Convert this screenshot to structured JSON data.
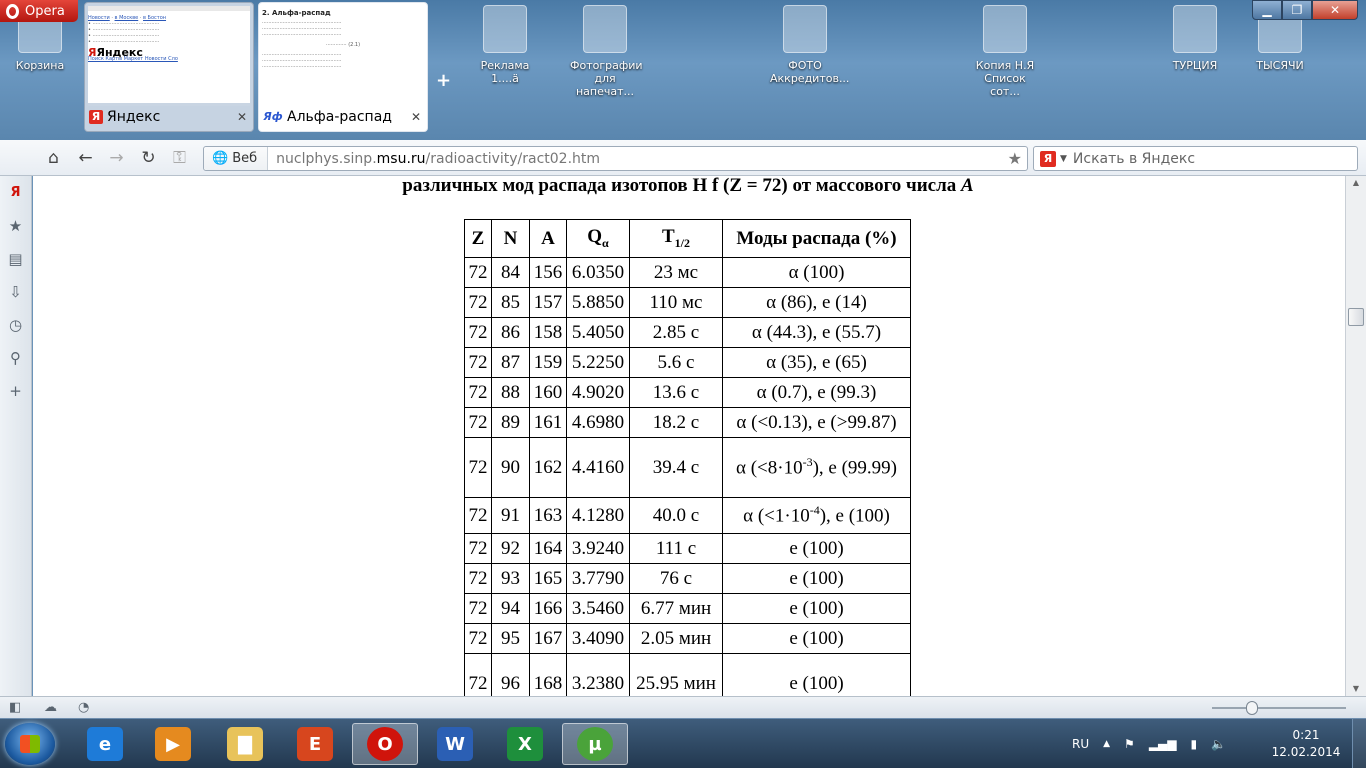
{
  "app": {
    "menu_label": "Opera",
    "window_controls": {
      "minimize": "▁",
      "maximize": "❐",
      "close": "✕"
    }
  },
  "desktop": {
    "icons": [
      "Корзина",
      "",
      "Реклама 1....ä",
      "Фотографии для напечат...",
      "ФОТО Аккредитов...",
      "",
      "Копия Н.Я Список сот...",
      "ТУРЦИЯ",
      "ТЫСЯЧИ"
    ]
  },
  "tabs": [
    {
      "title": "Яндекс",
      "favicon": "Я",
      "close": "✕",
      "thumb_lines": [
        "Новости",
        "в Москве",
        "в Бостон",
        "Яндекс"
      ],
      "thumb_nav": "Поиск Карты Маркет Новости Сло"
    },
    {
      "title": "Альфа-распад",
      "favicon": "Яф",
      "close": "✕",
      "thumb_heading": "2. Альфа-распад"
    }
  ],
  "new_tab": "+",
  "nav": {
    "home": "⌂",
    "back": "←",
    "forward": "→",
    "reload": "↻",
    "key": "⚿",
    "web_label": "Веб",
    "url_prefix": "nuclphys.sinp.",
    "url_domain": "msu.ru",
    "url_suffix": "/radioactivity/ract02.htm",
    "bookmark": "★",
    "search_placeholder": "Искать в Яндекс",
    "search_logo": "Я",
    "search_arrow": "▼"
  },
  "panel": {
    "icons": [
      {
        "name": "yandex-icon",
        "glyph": "Я"
      },
      {
        "name": "bookmarks-icon",
        "glyph": "★"
      },
      {
        "name": "notes-icon",
        "glyph": "▤"
      },
      {
        "name": "downloads-icon",
        "glyph": "⇩"
      },
      {
        "name": "history-icon",
        "glyph": "◷"
      },
      {
        "name": "search-panel-icon",
        "glyph": "⚲"
      },
      {
        "name": "add-panel-icon",
        "glyph": "+"
      }
    ]
  },
  "page": {
    "caption_text": "различных мод распада изотопов H f (Z = 72) от массового числа ",
    "caption_var": "A",
    "headers": {
      "z": "Z",
      "n": "N",
      "a": "A",
      "q": "Q",
      "q_sub": "α",
      "t": "T",
      "t_sub": "1/2",
      "modes": "Моды распада (%)"
    },
    "rows": [
      {
        "z": "72",
        "n": "84",
        "a": "156",
        "q": "6.0350",
        "t": "23 мс",
        "m": "α (100)"
      },
      {
        "z": "72",
        "n": "85",
        "a": "157",
        "q": "5.8850",
        "t": "110 мс",
        "m": "α (86), e (14)"
      },
      {
        "z": "72",
        "n": "86",
        "a": "158",
        "q": "5.4050",
        "t": "2.85 с",
        "m": "α (44.3), e (55.7)"
      },
      {
        "z": "72",
        "n": "87",
        "a": "159",
        "q": "5.2250",
        "t": "5.6 с",
        "m": "α (35), e (65)"
      },
      {
        "z": "72",
        "n": "88",
        "a": "160",
        "q": "4.9020",
        "t": "13.6 с",
        "m": "α (0.7), e (99.3)"
      },
      {
        "z": "72",
        "n": "89",
        "a": "161",
        "q": "4.6980",
        "t": "18.2 с",
        "m": "α (<0.13), e (>99.87)"
      },
      {
        "z": "72",
        "n": "90",
        "a": "162",
        "q": "4.4160",
        "t": "39.4 с",
        "m_pre": "α (<8·10",
        "m_sup": "-3",
        "m_post": "), e (99.99)"
      },
      {
        "z": "72",
        "n": "91",
        "a": "163",
        "q": "4.1280",
        "t": "40.0 с",
        "m_pre": "α (<1·10",
        "m_sup": "-4",
        "m_post": "), e (100)"
      },
      {
        "z": "72",
        "n": "92",
        "a": "164",
        "q": "3.9240",
        "t": "111 с",
        "m": "e (100)"
      },
      {
        "z": "72",
        "n": "93",
        "a": "165",
        "q": "3.7790",
        "t": "76 с",
        "m": "e (100)"
      },
      {
        "z": "72",
        "n": "94",
        "a": "166",
        "q": "3.5460",
        "t": "6.77 мин",
        "m": "e (100)"
      },
      {
        "z": "72",
        "n": "95",
        "a": "167",
        "q": "3.4090",
        "t": "2.05 мин",
        "m": "e (100)"
      },
      {
        "z": "72",
        "n": "96",
        "a": "168",
        "q": "3.2380",
        "t": "25.95 мин",
        "m": "e (100)"
      }
    ]
  },
  "scrollbar": {
    "up": "▲",
    "down": "▼"
  },
  "statusbar": {
    "panel_toggle": "◧",
    "turbo": "☁",
    "speed_dial": "◔"
  },
  "taskbar": {
    "apps": [
      {
        "name": "ie",
        "glyph": "e",
        "color": "#1e7bd8"
      },
      {
        "name": "media-player",
        "glyph": "▶",
        "color": "#e58a1f"
      },
      {
        "name": "explorer",
        "glyph": "▇",
        "color": "#e8c35a"
      },
      {
        "name": "powerpoint",
        "glyph": "E",
        "color": "#d7461e"
      },
      {
        "name": "opera",
        "glyph": "O",
        "color": "#d0140b"
      },
      {
        "name": "word",
        "glyph": "W",
        "color": "#2b5fb4"
      },
      {
        "name": "excel",
        "glyph": "X",
        "color": "#1e8f3c"
      },
      {
        "name": "utorrent",
        "glyph": "µ",
        "color": "#4aa33a"
      }
    ],
    "lang": "RU",
    "tray_up": "▲",
    "time": "0:21",
    "date": "12.02.2014"
  }
}
